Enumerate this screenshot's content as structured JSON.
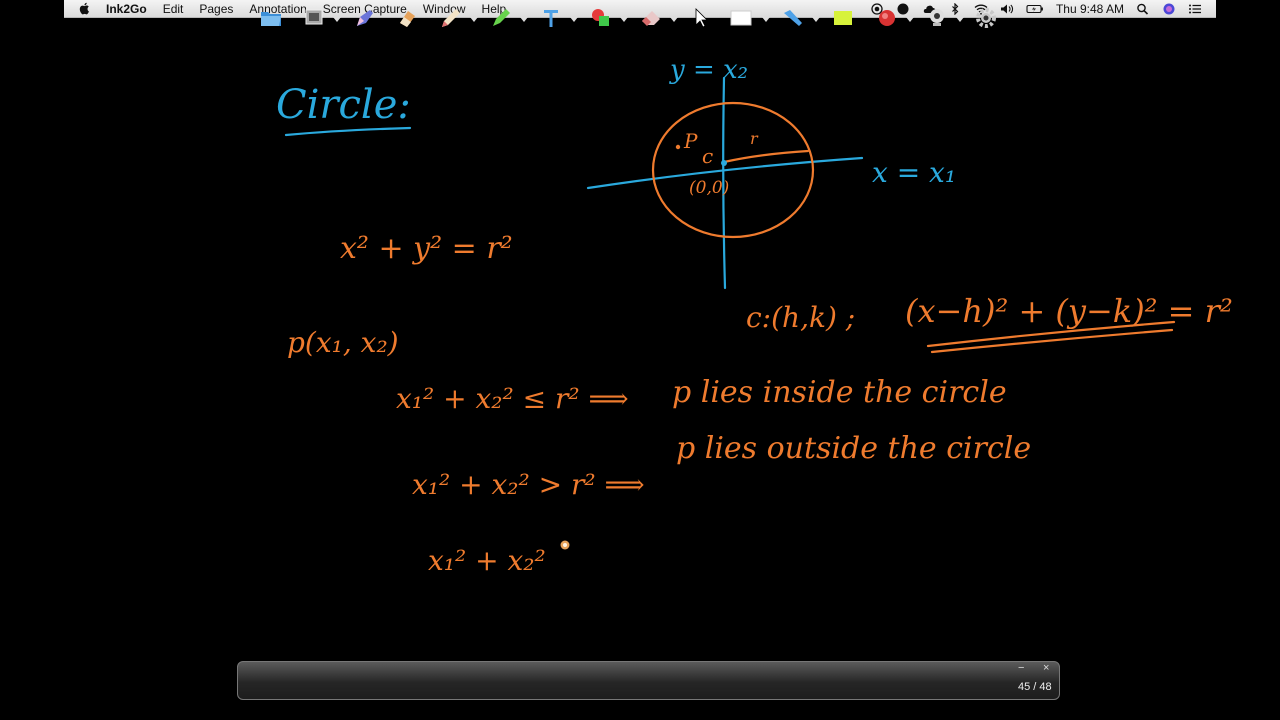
{
  "menubar": {
    "app_name": "Ink2Go",
    "menus": [
      "Edit",
      "Pages",
      "Annotation",
      "Screen Capture",
      "Window",
      "Help"
    ],
    "clock": "Thu 9:48 AM"
  },
  "board": {
    "title": "Circle:",
    "axis_y_label": "y = x₂",
    "axis_x_label": "x = x₁",
    "point_label": "P",
    "center_label": "c",
    "radius_label": "r",
    "origin_label": "(0,0)",
    "eq_circle": "x² + y² = r²",
    "point_def": "p(x₁, x₂)",
    "general_lhs": "c:(h,k) ;",
    "general_eq": "(x−h)² + (y−k)² = r²",
    "line1_lhs": "x₁² + x₂² ≤ r² ⟹",
    "line1_rhs": "p lies inside the circle",
    "line2_lhs": "x₁² + x₂² > r² ⟹",
    "line2_rhs": "p lies outside the circle",
    "line3_lhs": "x₁² + x₂²",
    "colors": {
      "orange": "#ef7b2e",
      "blue": "#2aa9dd"
    }
  },
  "toolbar": {
    "tools": [
      "folder-icon",
      "screen-capture-icon",
      "pen-icon",
      "eraser-icon",
      "pencil-icon",
      "highlighter-icon",
      "text-icon",
      "shape-icon",
      "clear-icon",
      "pointer-icon",
      "whiteboard-icon",
      "line-icon",
      "color-icon",
      "record-icon",
      "webcam-icon",
      "settings-icon"
    ],
    "page_counter": "45 / 48",
    "minimize": "−",
    "close": "×"
  }
}
